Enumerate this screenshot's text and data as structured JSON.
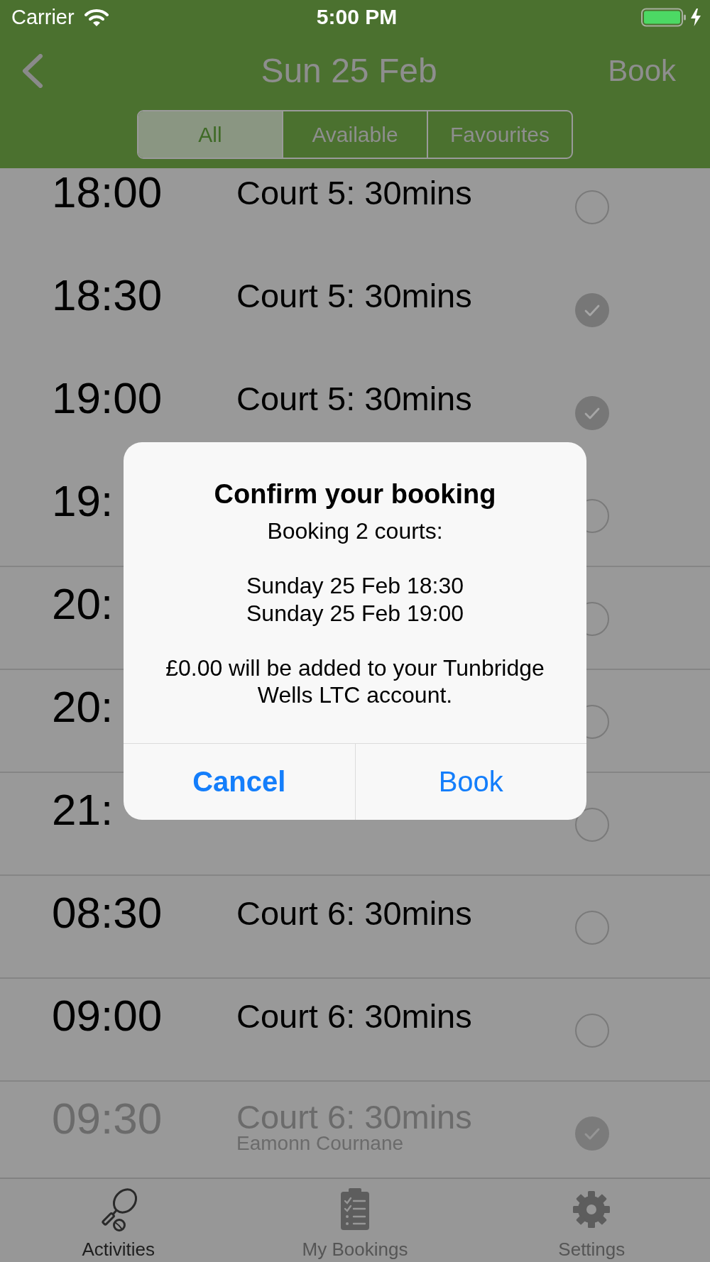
{
  "status_bar": {
    "carrier": "Carrier",
    "time": "5:00 PM"
  },
  "nav_bar": {
    "title": "Sun 25 Feb",
    "action": "Book"
  },
  "segments": [
    {
      "label": "All",
      "selected": true
    },
    {
      "label": "Available",
      "selected": false
    },
    {
      "label": "Favourites",
      "selected": false
    }
  ],
  "rows": [
    {
      "time": "18:00",
      "court": "Court 5: 30mins",
      "checked": false,
      "disabled": false,
      "divider": false
    },
    {
      "time": "18:30",
      "court": "Court 5: 30mins",
      "checked": true,
      "disabled": false,
      "divider": false
    },
    {
      "time": "19:00",
      "court": "Court 5: 30mins",
      "checked": true,
      "disabled": false,
      "divider": false
    },
    {
      "time": "19:",
      "checked": false,
      "disabled": false,
      "divider": true
    },
    {
      "time": "20:",
      "checked": false,
      "disabled": false,
      "divider": true
    },
    {
      "time": "20:",
      "checked": false,
      "disabled": false,
      "divider": true
    },
    {
      "time": "21:",
      "checked": false,
      "disabled": false,
      "divider": true
    },
    {
      "time": "08:30",
      "court": "Court 6: 30mins",
      "checked": false,
      "disabled": false,
      "divider": true
    },
    {
      "time": "09:00",
      "court": "Court 6: 30mins",
      "checked": false,
      "disabled": false,
      "divider": true
    },
    {
      "time": "09:30",
      "court": "Court 6: 30mins",
      "booked_by": "Eamonn Cournane",
      "checked": true,
      "disabled": true,
      "divider": false
    }
  ],
  "alert": {
    "title": "Confirm your booking",
    "message": "Booking 2 courts:\n\nSunday 25 Feb 18:30\nSunday 25 Feb 19:00\n\n£0.00 will be added to your Tunbridge Wells LTC account.",
    "buttons": [
      {
        "label": "Cancel",
        "kind": "cancel"
      },
      {
        "label": "Book",
        "kind": "default"
      }
    ]
  },
  "tab_bar": [
    {
      "label": "Activities",
      "selected": true
    },
    {
      "label": "My Bookings",
      "selected": false
    },
    {
      "label": "Settings",
      "selected": false
    }
  ]
}
